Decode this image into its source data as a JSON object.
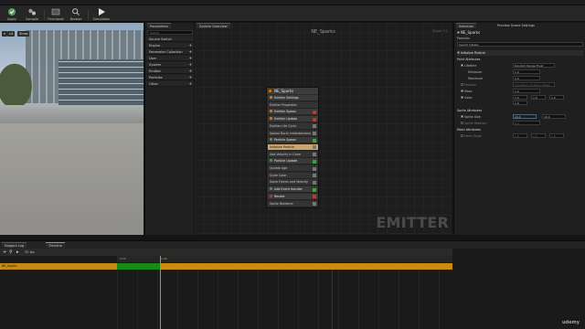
{
  "toolbar": {
    "buttons": [
      {
        "label": "Apply",
        "icon": "apply-icon"
      },
      {
        "label": "Compile",
        "icon": "compile-icon"
      },
      {
        "label": "Thumbnail",
        "icon": "thumbnail-icon"
      },
      {
        "label": "Browse",
        "icon": "browse-icon"
      },
      {
        "label": "Simulation",
        "icon": "play-icon"
      }
    ]
  },
  "viewport": {
    "view_mode": "Lit",
    "perspective": "Show"
  },
  "params": {
    "tab": "Parameters",
    "search_placeholder": "Search",
    "rows": [
      {
        "label": "Source Switch"
      },
      {
        "label": "Engine",
        "expandable": true
      },
      {
        "label": "Parameter Collection",
        "expandable": true
      },
      {
        "label": "User",
        "expandable": true
      },
      {
        "label": "System",
        "expandable": true
      },
      {
        "label": "Emitter",
        "expandable": true
      },
      {
        "label": "Particles",
        "expandable": true
      },
      {
        "label": "Other",
        "expandable": true
      }
    ]
  },
  "system_overview": {
    "tab": "System Overview",
    "title": "NE_Sparks",
    "zoom": "Zoom 1:1",
    "watermark": "EMITTER"
  },
  "node": {
    "title": "NE_Sparks",
    "rows": [
      {
        "label": "Emitter Settings",
        "kind": "sec",
        "dot": "#d77f1e",
        "chip": ""
      },
      {
        "label": "Emitter Properties",
        "kind": "row",
        "dot": "",
        "chip": ""
      },
      {
        "label": "Emitter Spawn",
        "kind": "sec",
        "dot": "#d77f1e",
        "chip": "#c0392b"
      },
      {
        "label": "Emitter Update",
        "kind": "sec",
        "dot": "#d77f1e",
        "chip": "#c0392b"
      },
      {
        "label": "Emitter Life Cycle",
        "kind": "row",
        "dot": "",
        "chip": "#777"
      },
      {
        "label": "Spawn Burst Instantaneous",
        "kind": "row",
        "dot": "",
        "chip": "#777"
      },
      {
        "label": "Particle Spawn",
        "kind": "sec",
        "dot": "#3aa63a",
        "chip": "#3aa63a"
      },
      {
        "label": "Initialize Particle",
        "kind": "hl",
        "dot": "",
        "chip": "#777"
      },
      {
        "label": "Add Velocity in Cone",
        "kind": "row",
        "dot": "",
        "chip": "#777"
      },
      {
        "label": "Particle Update",
        "kind": "sec",
        "dot": "#3aa63a",
        "chip": "#3aa63a"
      },
      {
        "label": "Update Age",
        "kind": "row",
        "dot": "",
        "chip": "#777"
      },
      {
        "label": "Scale Color",
        "kind": "row",
        "dot": "",
        "chip": "#777"
      },
      {
        "label": "Solve Forces and Velocity",
        "kind": "row",
        "dot": "",
        "chip": "#777"
      },
      {
        "label": "Add Event Handler",
        "kind": "sec",
        "dot": "#3aa63a",
        "chip": "#3aa63a"
      },
      {
        "label": "Render",
        "kind": "sec",
        "dot": "#c0392b",
        "chip": "#c0392b"
      },
      {
        "label": "Sprite Renderer",
        "kind": "row",
        "dot": "",
        "chip": "#777"
      }
    ]
  },
  "details": {
    "tab": "Selection",
    "tab2": "Preview Scene Settings",
    "emitter": "NE_Sparks",
    "subtitle": "Particles",
    "search_placeholder": "Search Details",
    "section": "Initialize Particle",
    "group1": "Point Attributes",
    "lifetime": "Lifetime",
    "lifetime_mode": "Random Range Float",
    "minimum": "Minimum",
    "minimum_val": "1.0",
    "maximum": "Maximum",
    "maximum_val": "2.0",
    "position": "Position",
    "position_mode": "Simulation Position Offset",
    "mass": "Mass",
    "color": "Color",
    "sprite_group": "Sprite Attributes",
    "sprite_size": "Sprite Size",
    "sprite_rotation": "Sprite Rotation",
    "mesh_group": "Mesh Attributes",
    "mesh_scale": "Mesh Scale",
    "value_zero": "0.0",
    "value_one": "1.0",
    "value_ten": "10.0"
  },
  "bottom": {
    "tab1": "Niagara Log",
    "tab2": "Timeline",
    "track": "NE_Sparks",
    "frame_start": "0.00",
    "frame_marker": "1.00",
    "fps": "30 fps"
  },
  "watermark": "udemy"
}
